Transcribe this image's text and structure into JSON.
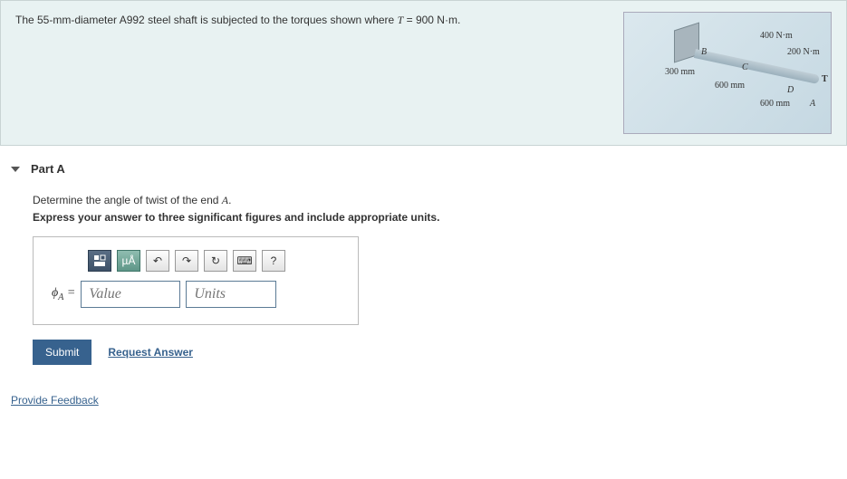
{
  "problem": {
    "text_prefix": "The 55-mm-diameter A992 steel shaft is subjected to the torques shown where ",
    "equation_lhs": "T",
    "equation_eq": " = ",
    "equation_rhs": "900 N·m",
    "text_suffix": "."
  },
  "figure": {
    "label_400": "400 N·m",
    "label_200": "200 N·m",
    "label_B": "B",
    "label_C": "C",
    "label_D": "D",
    "label_T": "T",
    "label_A": "A",
    "dim_300": "300 mm",
    "dim_600a": "600 mm",
    "dim_600b": "600 mm"
  },
  "part": {
    "title": "Part A",
    "prompt_prefix": "Determine the angle of twist of the end ",
    "prompt_var": "A",
    "prompt_suffix": ".",
    "instruction": "Express your answer to three significant figures and include appropriate units."
  },
  "toolbar": {
    "template_icon_title": "Templates",
    "mu_label": "µÅ",
    "undo_glyph": "↶",
    "redo_glyph": "↷",
    "reset_glyph": "↻",
    "keyboard_glyph": "⌨",
    "help_glyph": "?"
  },
  "input": {
    "symbol_html": "ϕ",
    "symbol_sub": "A",
    "equals": " = ",
    "value_placeholder": "Value",
    "units_placeholder": "Units"
  },
  "actions": {
    "submit": "Submit",
    "request_answer": "Request Answer",
    "provide_feedback": "Provide Feedback"
  }
}
